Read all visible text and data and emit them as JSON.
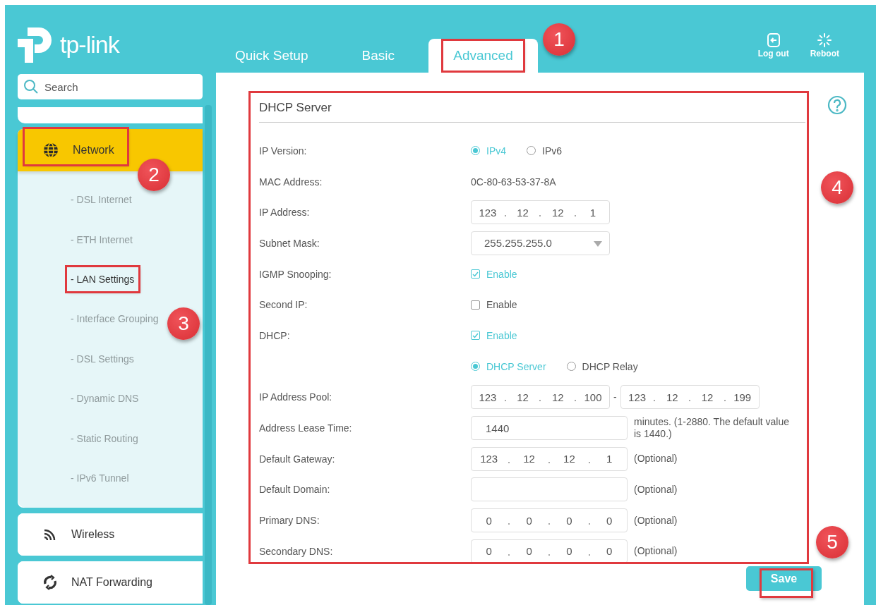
{
  "header": {
    "logo_text": "tp-link",
    "tabs": [
      {
        "label": "Quick Setup",
        "selected": false,
        "highlighted": false
      },
      {
        "label": "Basic",
        "selected": false,
        "highlighted": false
      },
      {
        "label": "Advanced",
        "selected": true,
        "highlighted": true,
        "callout": "1"
      }
    ],
    "actions": [
      {
        "kind": "logout",
        "label": "Log out"
      },
      {
        "kind": "reboot",
        "label": "Reboot"
      }
    ]
  },
  "sidebar": {
    "search": {
      "placeholder": "Search"
    },
    "sections": [
      {
        "kind": "network",
        "label": "Network",
        "selected": true,
        "expanded": true,
        "highlighted": true,
        "callout": "2",
        "children": [
          {
            "label": "- DSL Internet",
            "selected": false,
            "highlighted": false
          },
          {
            "label": "- ETH Internet",
            "selected": false,
            "highlighted": false
          },
          {
            "label": "- LAN Settings",
            "selected": true,
            "highlighted": true
          },
          {
            "label": "- Interface Grouping",
            "selected": false,
            "highlighted": false,
            "callout": "3"
          },
          {
            "label": "- DSL Settings",
            "selected": false,
            "highlighted": false
          },
          {
            "label": "- Dynamic DNS",
            "selected": false,
            "highlighted": false
          },
          {
            "label": "- Static Routing",
            "selected": false,
            "highlighted": false
          },
          {
            "label": "- IPv6 Tunnel",
            "selected": false,
            "highlighted": false
          }
        ]
      },
      {
        "kind": "wireless",
        "label": "Wireless",
        "selected": false,
        "expanded": false,
        "highlighted": false
      },
      {
        "kind": "nat",
        "label": "NAT Forwarding",
        "selected": false,
        "expanded": false,
        "highlighted": false
      }
    ]
  },
  "form": {
    "title": "DHCP Server",
    "highlighted": true,
    "callout": "4",
    "rows": [
      {
        "label": "IP Version:",
        "kind": "radio",
        "options": [
          {
            "label": "IPv4",
            "selected": true
          },
          {
            "label": "IPv6",
            "selected": false
          }
        ]
      },
      {
        "label": "MAC Address:",
        "kind": "text",
        "value": "0C-80-63-53-37-8A"
      },
      {
        "label": "IP Address:",
        "kind": "ip",
        "octets": [
          "123",
          "12",
          "12",
          "1"
        ]
      },
      {
        "label": "Subnet Mask:",
        "kind": "select",
        "value": "255.255.255.0"
      },
      {
        "label": "IGMP Snooping:",
        "kind": "checkbox",
        "option": "Enable",
        "checked": true
      },
      {
        "label": "Second IP:",
        "kind": "checkbox",
        "option": "Enable",
        "checked": false
      },
      {
        "label": "DHCP:",
        "kind": "checkbox",
        "option": "Enable",
        "checked": true
      },
      {
        "kind": "radio",
        "options": [
          {
            "label": "DHCP Server",
            "selected": true
          },
          {
            "label": "DHCP Relay",
            "selected": false
          }
        ]
      },
      {
        "label": "IP Address Pool:",
        "kind": "ip_range",
        "start": [
          "123",
          "12",
          "12",
          "100"
        ],
        "separator": "-",
        "end": [
          "123",
          "12",
          "12",
          "199"
        ]
      },
      {
        "label": "Address Lease Time:",
        "kind": "input",
        "value": "1440",
        "note": "minutes. (1-2880. The default value is 1440.)"
      },
      {
        "label": "Default Gateway:",
        "kind": "ip",
        "octets": [
          "123",
          "12",
          "12",
          "1"
        ],
        "note": "(Optional)"
      },
      {
        "label": "Default Domain:",
        "kind": "input",
        "note": "(Optional)"
      },
      {
        "label": "Primary DNS:",
        "kind": "ip",
        "octets": [
          "0",
          "0",
          "0",
          "0"
        ],
        "note": "(Optional)"
      },
      {
        "label": "Secondary DNS:",
        "kind": "ip",
        "octets": [
          "0",
          "0",
          "0",
          "0"
        ],
        "note": "(Optional)"
      }
    ]
  },
  "save_button": {
    "label": "Save",
    "highlighted": true,
    "callout": "5"
  }
}
